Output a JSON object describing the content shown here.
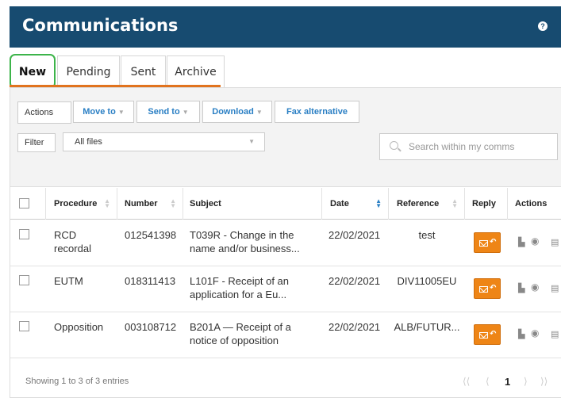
{
  "header": {
    "title": "Communications",
    "help_icon": "?"
  },
  "tabs": [
    {
      "label": "New",
      "active": true
    },
    {
      "label": "Pending"
    },
    {
      "label": "Sent"
    },
    {
      "label": "Archive"
    }
  ],
  "toolbar": {
    "actions_label": "Actions",
    "buttons": [
      "Move to",
      "Send to",
      "Download",
      "Fax alternative"
    ],
    "filter_label": "Filter",
    "filter_value": "All files",
    "search_placeholder": "Search within my comms"
  },
  "table": {
    "columns": [
      "Procedure",
      "Number",
      "Subject",
      "Date",
      "Reference",
      "Reply",
      "Actions"
    ],
    "rows": [
      {
        "procedure_l1": "RCD",
        "procedure_l2": "recordal",
        "number": "012541398",
        "subject_l1": "T039R - Change in the",
        "subject_l2": "name and/or business...",
        "date": "22/02/2021",
        "reference": "test"
      },
      {
        "procedure_l1": "EUTM",
        "procedure_l2": "",
        "number": "018311413",
        "subject_l1": "L101F - Receipt of an",
        "subject_l2": "application for a Eu...",
        "date": "22/02/2021",
        "reference": "DIV11005EU"
      },
      {
        "procedure_l1": "Opposition",
        "procedure_l2": "",
        "number": "003108712",
        "subject_l1": "B201A — Receipt of a",
        "subject_l2": "notice of opposition",
        "date": "22/02/2021",
        "reference": "ALB/FUTUR..."
      }
    ]
  },
  "footer": {
    "entries_text": "Showing 1 to 3 of 3 entries",
    "pager": {
      "first": "⟨⟨",
      "prev": "⟨",
      "current": "1",
      "next": "⟩",
      "last": "⟩⟩"
    }
  },
  "colors": {
    "header_bg": "#174b70",
    "accent": "#e1731e",
    "reply_button": "#ee8516",
    "link": "#2a7fc4",
    "tab_highlight": "#3db44a"
  }
}
